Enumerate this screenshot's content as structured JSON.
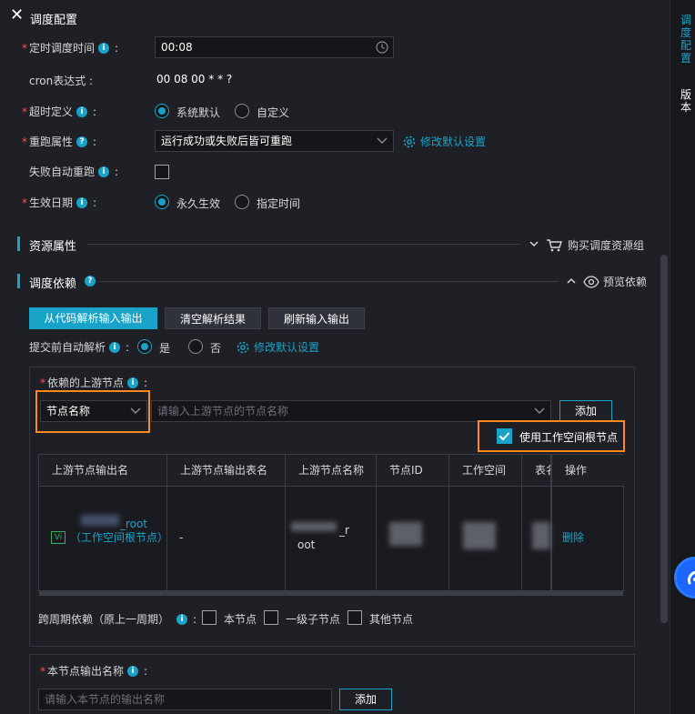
{
  "header": {
    "title": "调度配置"
  },
  "schedule": {
    "time_label": "定时调度时间",
    "time_value": "00:08",
    "cron_label": "cron表达式 :",
    "cron_value": "00 08 00 * * ?",
    "timeout_label": "超时定义",
    "timeout_options": [
      "系统默认",
      "自定义"
    ],
    "timeout_selected": "系统默认",
    "rerun_label": "重跑属性",
    "rerun_value": "运行成功或失败后皆可重跑",
    "modify_default": "修改默认设置",
    "auto_rerun_label": "失败自动重跑",
    "effective_label": "生效日期",
    "effective_options": [
      "永久生效",
      "指定时间"
    ],
    "effective_selected": "永久生效"
  },
  "resource": {
    "title": "资源属性",
    "buy_link": "购买调度资源组"
  },
  "dependency": {
    "title": "调度依赖",
    "preview_link": "预览依赖",
    "buttons": {
      "parse": "从代码解析输入输出",
      "clear": "清空解析结果",
      "refresh": "刷新输入输出"
    },
    "auto_parse_label": "提交前自动解析",
    "auto_parse_options": [
      "是",
      "否"
    ],
    "auto_parse_selected": "是",
    "modify_default": "修改默认设置",
    "upstream_label": "依赖的上游节点",
    "search_type": "节点名称",
    "search_placeholder": "请输入上游节点的节点名称",
    "add_button": "添加",
    "use_root_label": "使用工作空间根节点",
    "use_root_checked": true,
    "table": {
      "headers": [
        "上游节点输出名",
        "上游节点输出表名",
        "上游节点名称",
        "节点ID",
        "工作空间",
        "表名",
        "操作"
      ],
      "row": {
        "output_name_suffix": "_root",
        "output_name_note": "（工作空间根节点）",
        "vi_badge": "Vi",
        "table_name": "-",
        "node_name_suffix": "_r",
        "node_name_tail": "oot",
        "action": "删除"
      }
    },
    "cross_cycle_label": "跨周期依赖（原上一周期）",
    "cross_cycle_options": [
      "本节点",
      "一级子节点",
      "其他节点"
    ]
  },
  "output": {
    "label": "本节点输出名称",
    "placeholder": "请输入本节点的输出名称",
    "add_button": "添加"
  },
  "rail": {
    "schedule_tab": "调度配置",
    "version_tab": "版本"
  }
}
